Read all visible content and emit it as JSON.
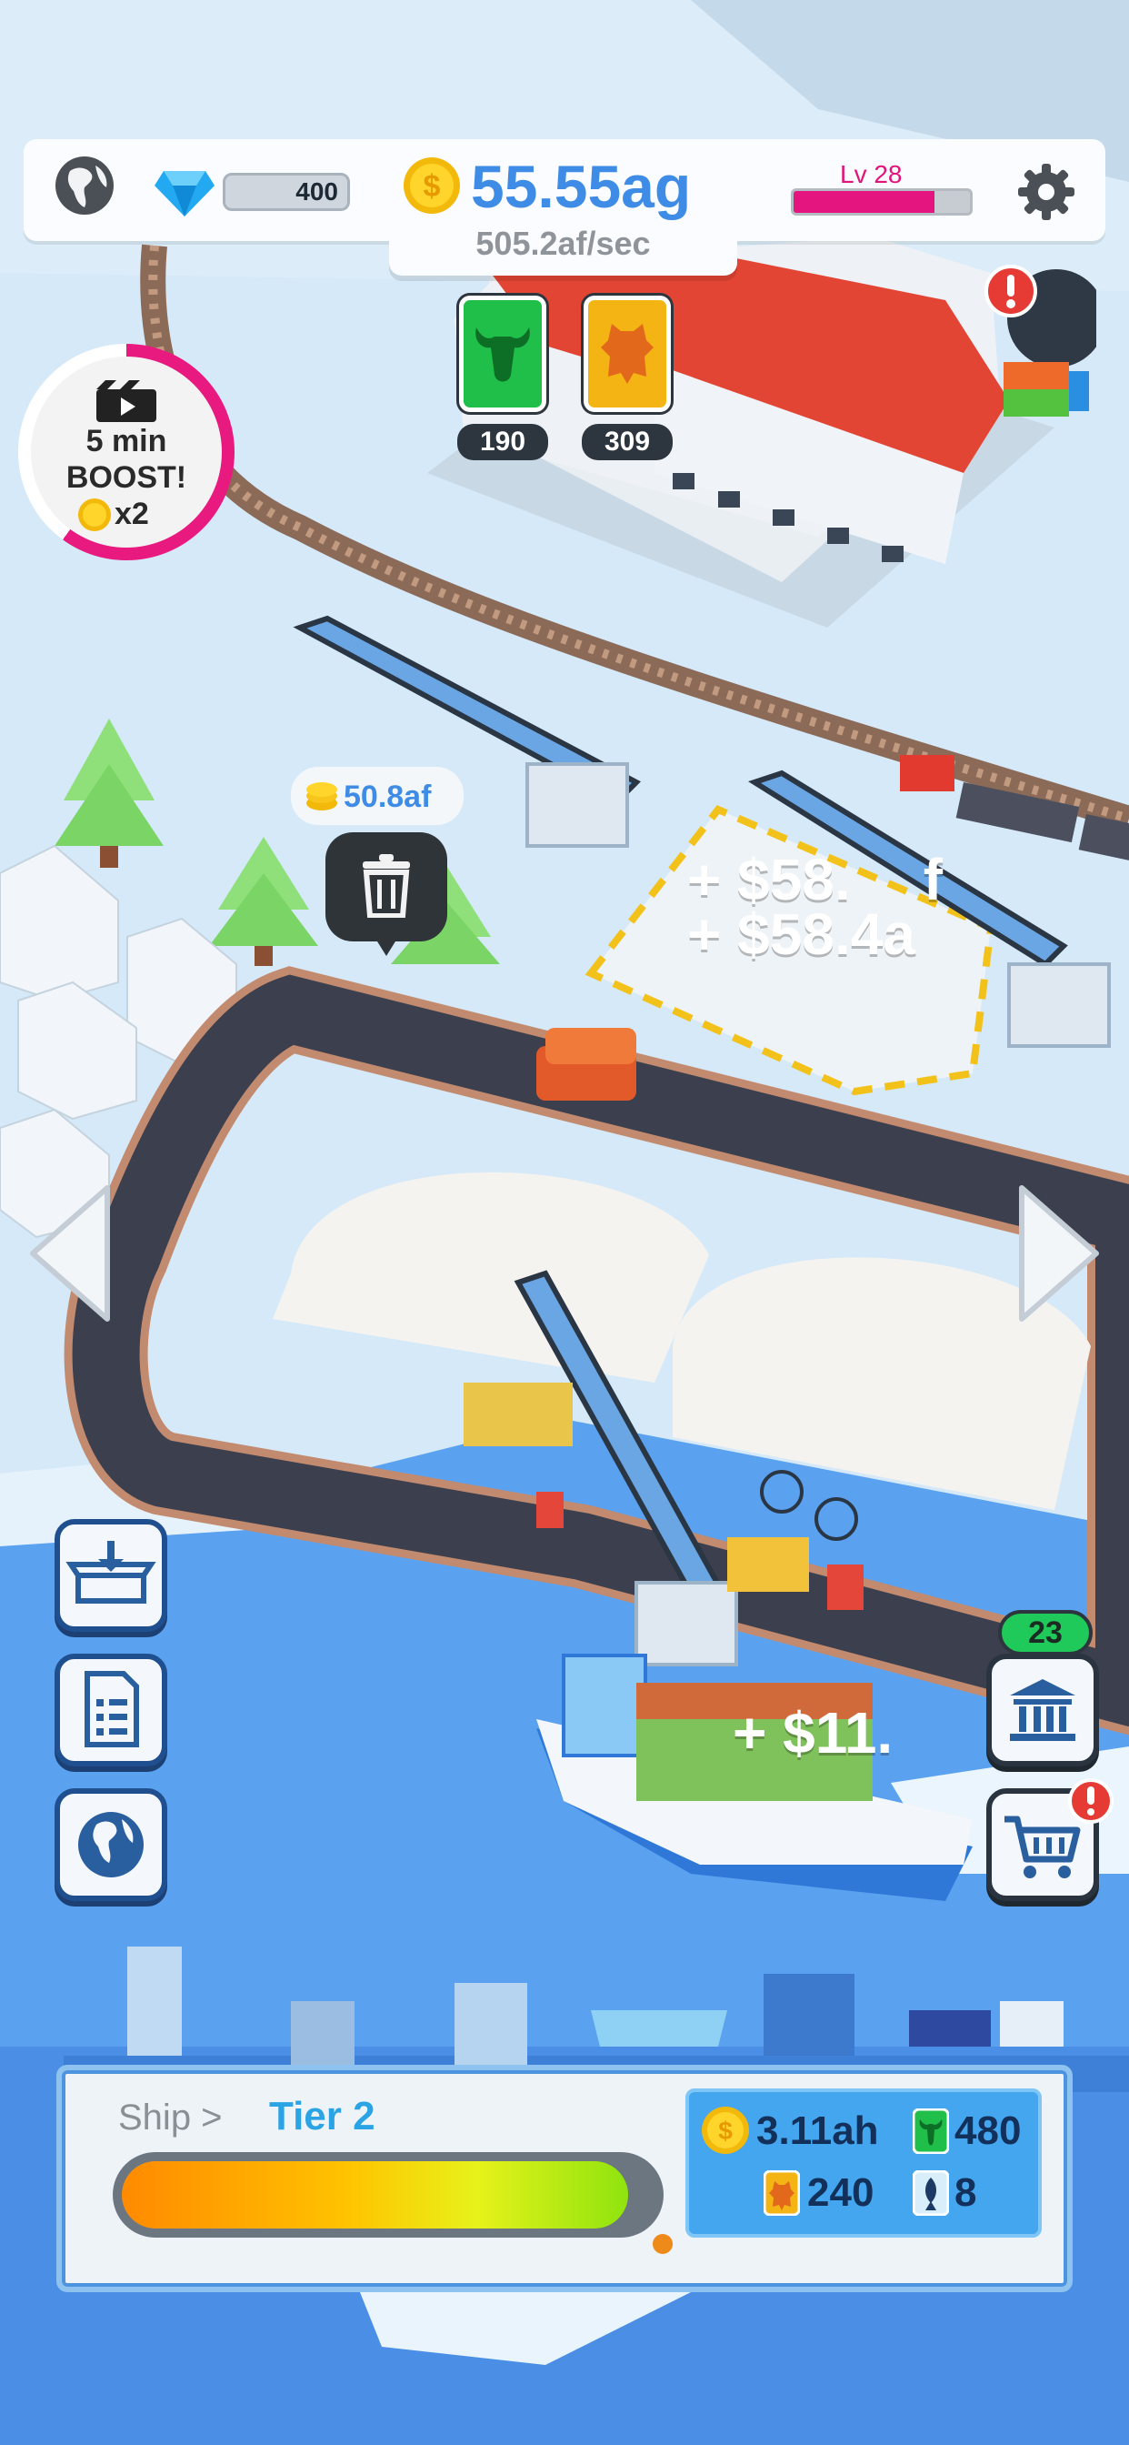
{
  "colors": {
    "sea": "#5aa1ef",
    "snow": "#e6f2fb",
    "accent_blue": "#3e8ce5",
    "level_pink": "#e5157f",
    "panel_blue": "#43a6ee"
  },
  "hud": {
    "globe_icon": "globe-icon",
    "gems": "400",
    "money": "55.55ag",
    "rate": "505.2af/sec",
    "level": "Lv 28",
    "level_progress": 0.8,
    "settings_icon": "gear-icon"
  },
  "resources": [
    {
      "icon": "bull-icon",
      "count": "190",
      "color": "#1fbf4a"
    },
    {
      "icon": "leather-icon",
      "count": "309",
      "color": "#f4b414"
    }
  ],
  "boost": {
    "line1": "5 min",
    "line2": "BOOST!",
    "line3": "x2",
    "progress": 0.6
  },
  "world": {
    "coin_tag": "50.8af",
    "float1": "+ $58.",
    "float1_suffix": "f",
    "float2": "+ $58.4a",
    "float3": "+ $11."
  },
  "side_right": {
    "badge": "23"
  },
  "bottom": {
    "crumb": "Ship >",
    "tier": "Tier 2",
    "progress": 0.95,
    "stats": {
      "coins": "3.11ah",
      "bull": "480",
      "leather": "240",
      "fish": "8"
    }
  }
}
